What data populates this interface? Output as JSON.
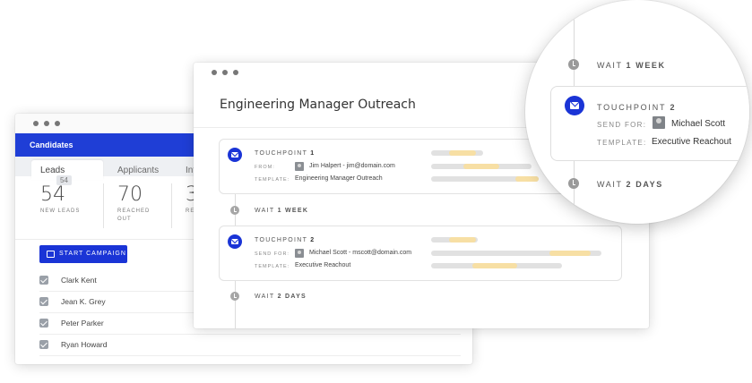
{
  "candidates_window": {
    "header_title": "Candidates",
    "tabs": [
      {
        "label": "Leads",
        "badge": "54"
      },
      {
        "label": "Applicants"
      },
      {
        "label": "Int"
      }
    ],
    "stats": [
      {
        "number": "54",
        "label": "NEW LEADS"
      },
      {
        "number": "70",
        "label": "REACHED OUT"
      },
      {
        "number": "3",
        "label": "RES"
      }
    ],
    "campaign_button": "START CAMPAIGN",
    "candidates": [
      "Clark Kent",
      "Jean K. Grey",
      "Peter Parker",
      "Ryan Howard"
    ]
  },
  "outreach_window": {
    "title": "Engineering Manager Outreach",
    "touchpoint1": {
      "title_prefix": "TOUCHPOINT",
      "number": "1",
      "from_label": "FROM:",
      "from_value": "Jim Halpert - jim@domain.com",
      "template_label": "TEMPLATE:",
      "template_value": "Engineering Manager Outreach"
    },
    "wait1": {
      "prefix": "WAIT",
      "amount": "1 WEEK"
    },
    "touchpoint2": {
      "title_prefix": "TOUCHPOINT",
      "number": "2",
      "send_label": "SEND FOR:",
      "send_value": "Michael Scott - mscott@domain.com",
      "template_label": "TEMPLATE:",
      "template_value": "Executive Reachout"
    },
    "wait2": {
      "prefix": "WAIT",
      "amount": "2 DAYS"
    }
  },
  "magnifier": {
    "wait_top": {
      "prefix": "WAIT",
      "amount": "1 WEEK"
    },
    "touchpoint": {
      "title_prefix": "TOUCHPOINT",
      "number": "2"
    },
    "send_label": "SEND FOR:",
    "send_value": "Michael Scott",
    "template_label": "TEMPLATE:",
    "template_value": "Executive Reachout",
    "wait_bottom": {
      "prefix": "WAIT",
      "amount": "2 DAYS"
    }
  },
  "colors": {
    "accent": "#1a34d6",
    "header_blue": "#1f3ed6",
    "highlight": "#f7dfa4"
  }
}
